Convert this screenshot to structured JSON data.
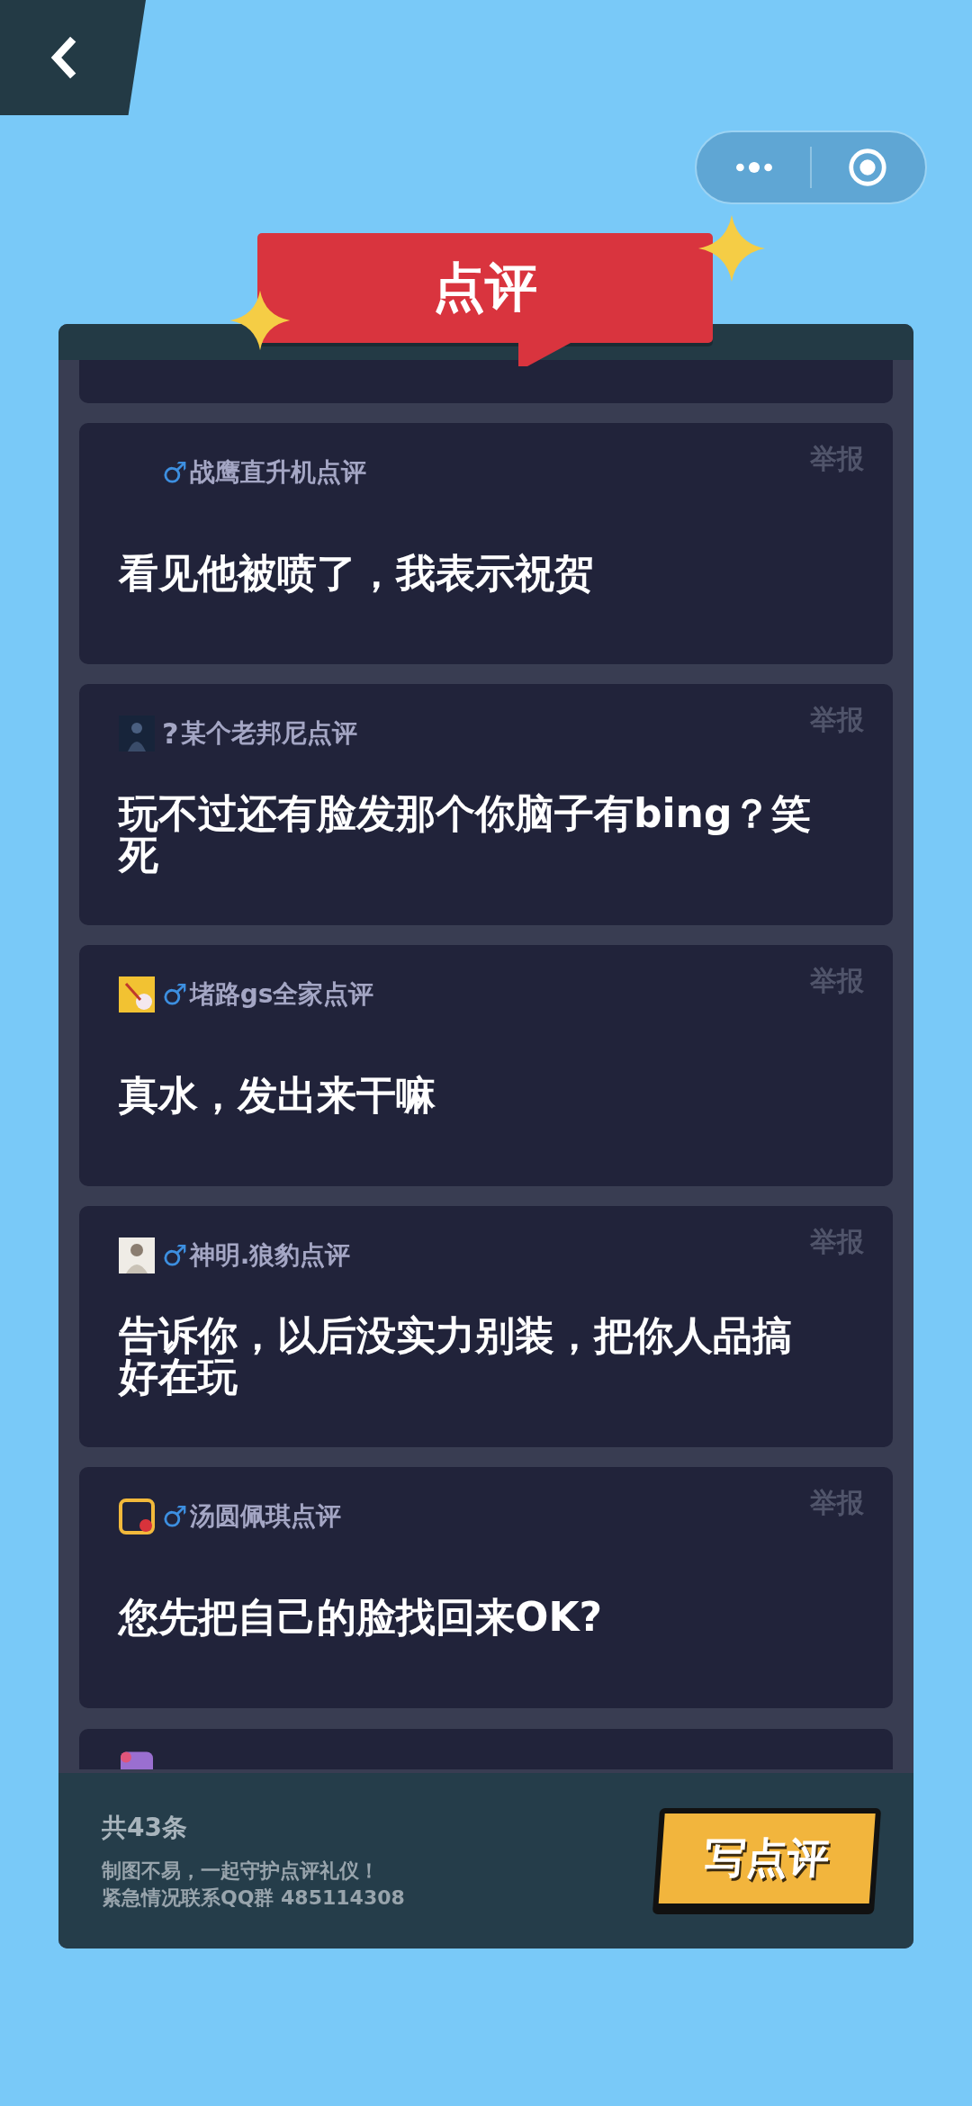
{
  "title": "点评",
  "comments": [
    {
      "kind": "cut_top"
    },
    {
      "kind": "full",
      "gender": {
        "kind": "male",
        "symbol": "♂"
      },
      "author": "战鹰直升机点评",
      "report": "举报",
      "text": "看见他被喷了，我表示祝贺"
    },
    {
      "kind": "full",
      "avatar": {
        "kind": "dark"
      },
      "gender": {
        "kind": "unknown",
        "symbol": "?"
      },
      "author": "某个老邦尼点评",
      "report": "举报",
      "text": "玩不过还有脸发那个你脑子有bing？笑死"
    },
    {
      "kind": "full",
      "avatar": {
        "kind": "yellow"
      },
      "gender": {
        "kind": "male",
        "symbol": "♂"
      },
      "author": "堵路gs全家点评",
      "report": "举报",
      "text": "真水，发出来干嘛"
    },
    {
      "kind": "full",
      "avatar": {
        "kind": "light"
      },
      "gender": {
        "kind": "male",
        "symbol": "♂"
      },
      "author": "神明.狼豹点评",
      "report": "举报",
      "text": "告诉你，以后没实力别装，把你人品搞好在玩"
    },
    {
      "kind": "full",
      "avatar": {
        "kind": "frame"
      },
      "gender": {
        "kind": "male",
        "symbol": "♂"
      },
      "author": "汤圆佩琪点评",
      "report": "举报",
      "text": "您先把自己的脸找回来OK?"
    },
    {
      "kind": "cut_bottom",
      "avatar": {
        "kind": "purple"
      }
    }
  ],
  "footer": {
    "count": "共43条",
    "notice": [
      "制图不易，一起守护点评礼仪！",
      "紧急情况联系QQ群 485114308"
    ],
    "button": "写点评"
  }
}
